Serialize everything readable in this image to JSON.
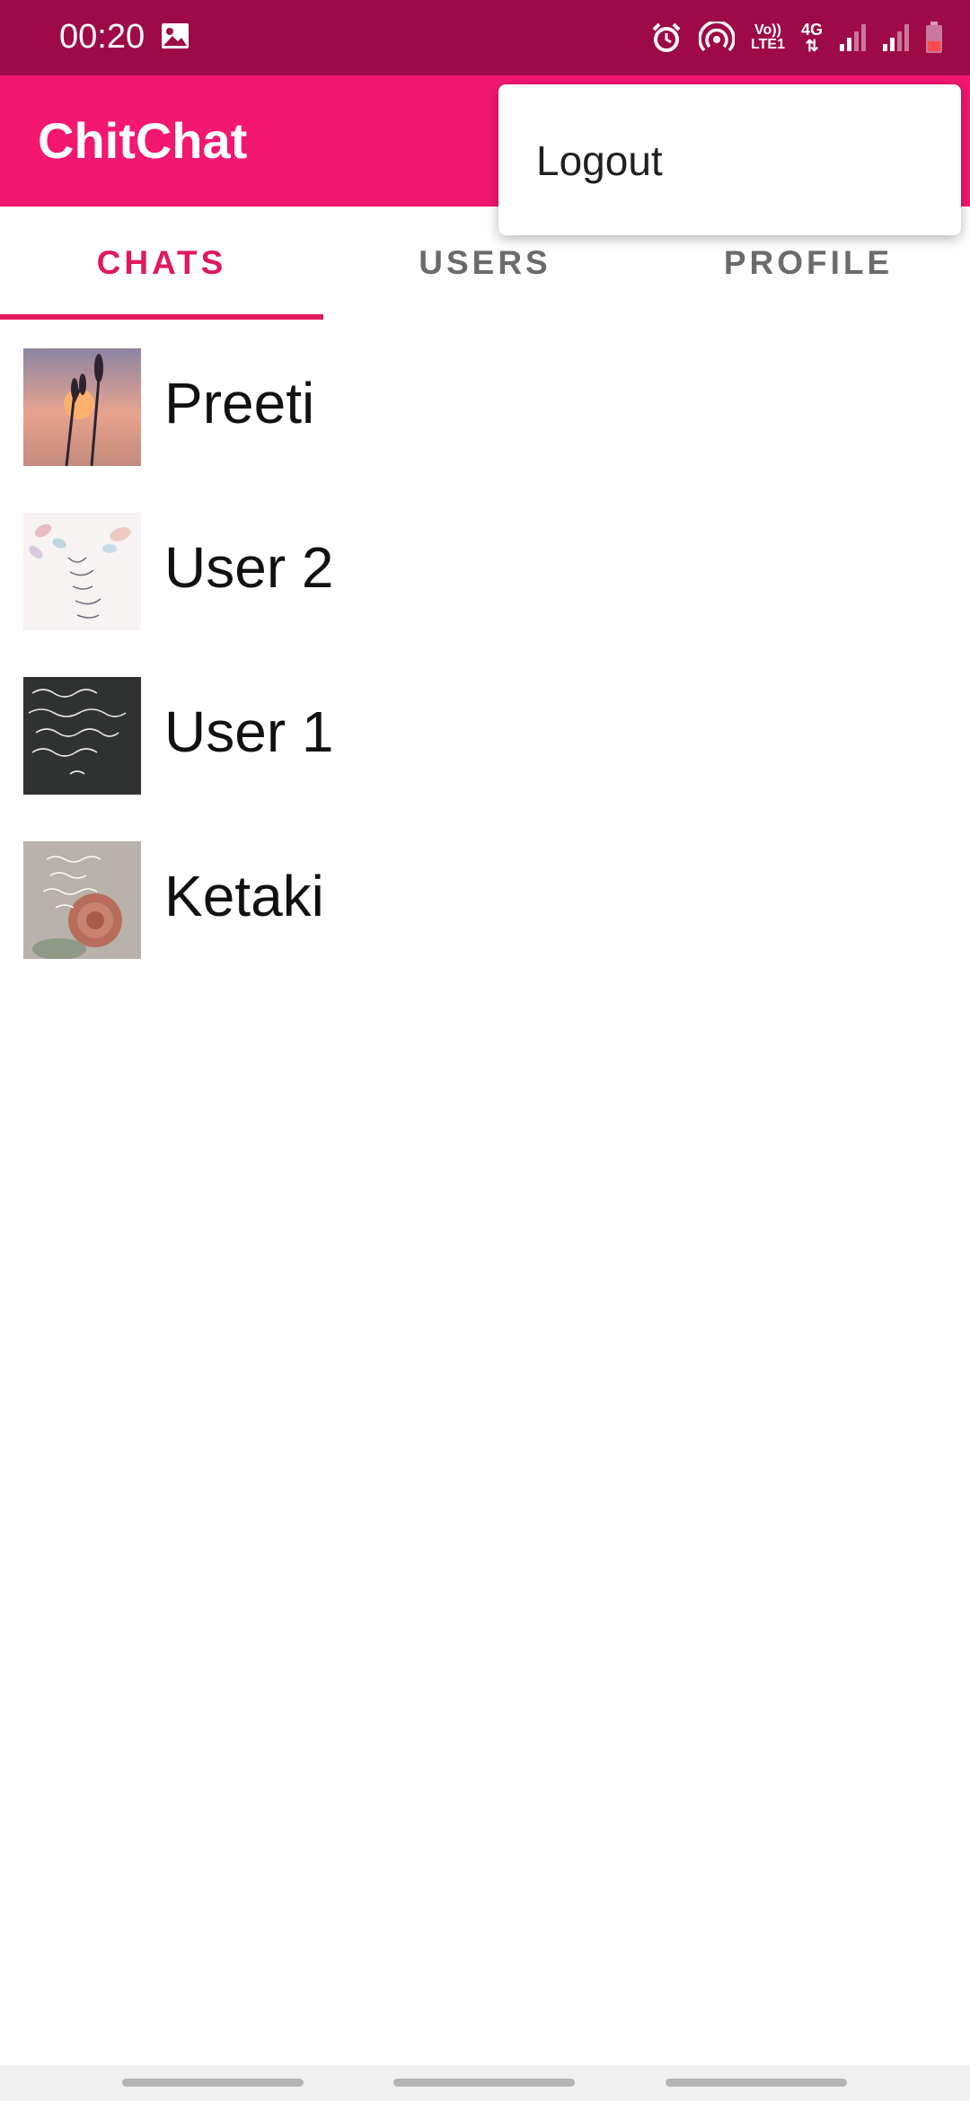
{
  "status_bar": {
    "time": "00:20",
    "volte_top": "Vo))",
    "volte_bottom": "LTE1",
    "network": "4G",
    "icons": [
      "gallery-icon",
      "alarm-icon",
      "hotspot-icon",
      "signal-icon",
      "signal-icon",
      "battery-icon"
    ]
  },
  "app_bar": {
    "title": "ChitChat"
  },
  "tabs": [
    {
      "label": "CHATS",
      "active": true
    },
    {
      "label": "USERS",
      "active": false
    },
    {
      "label": "PROFILE",
      "active": false
    }
  ],
  "chats": [
    {
      "name": "Preeti",
      "avatar": "sunset-lavender-photo"
    },
    {
      "name": "User 2",
      "avatar": "floral-quote-image"
    },
    {
      "name": "User 1",
      "avatar": "dark-quote-image"
    },
    {
      "name": "Ketaki",
      "avatar": "rose-quote-image"
    }
  ],
  "menu": {
    "logout_label": "Logout"
  },
  "colors": {
    "status_bar": "#9e0a45",
    "app_bar": "#f41770",
    "accent": "#e0195f",
    "tab_inactive": "#6b6b6b"
  }
}
